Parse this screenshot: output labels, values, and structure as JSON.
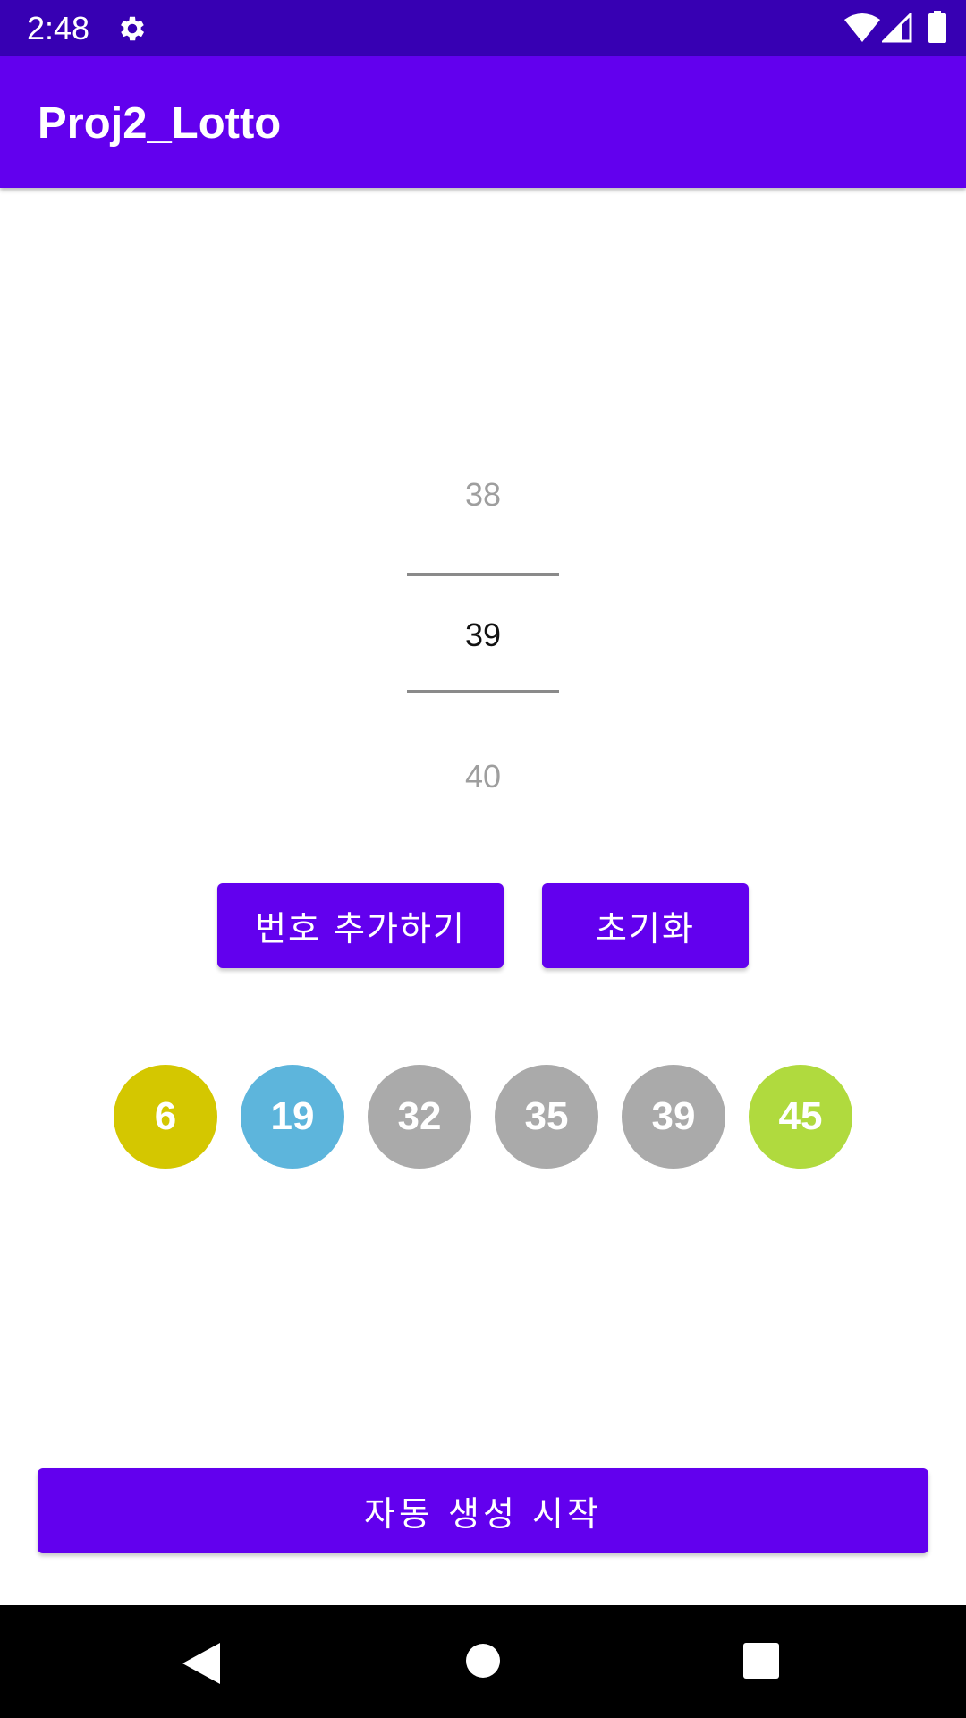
{
  "status_bar": {
    "time": "2:48",
    "icons": [
      "gear-icon",
      "wifi-icon",
      "signal-icon",
      "battery-icon"
    ]
  },
  "app_bar": {
    "title": "Proj2_Lotto"
  },
  "number_picker": {
    "previous": "38",
    "current": "39",
    "next": "40"
  },
  "buttons": {
    "add_number": "번호 추가하기",
    "reset": "초기화",
    "auto_generate": "자동 생성 시작"
  },
  "balls": [
    {
      "number": "6",
      "color": "#D4C700"
    },
    {
      "number": "19",
      "color": "#5DB5DC"
    },
    {
      "number": "32",
      "color": "#AAAAAA"
    },
    {
      "number": "35",
      "color": "#AAAAAA"
    },
    {
      "number": "39",
      "color": "#AAAAAA"
    },
    {
      "number": "45",
      "color": "#B0DA3E"
    }
  ],
  "colors": {
    "primary": "#6200EE",
    "primary_dark": "#3700B3"
  },
  "nav_bar": {
    "icons": [
      "back-icon",
      "home-icon",
      "recents-icon"
    ]
  }
}
